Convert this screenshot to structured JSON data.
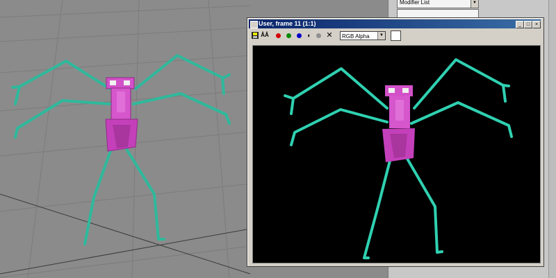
{
  "window": {
    "title": "User, frame 11 (1:1)",
    "minimize_label": "_",
    "maximize_label": "□",
    "close_label": "×"
  },
  "toolbar": {
    "save_icon": "save-icon",
    "clone_icon": "clone-icon",
    "clone_label": "ÂÂ",
    "red_channel_color": "#d40000",
    "green_channel_color": "#008a00",
    "blue_channel_color": "#0000c8",
    "mono_label": "◐",
    "clear_label": "✕",
    "channel_value": "RGB Alpha",
    "channel_dropdown": "▼"
  },
  "command_panel": {
    "modifier_list": "Modifier List",
    "dropdown": "▼"
  },
  "colors": {
    "skeleton": "#2fd1b1",
    "body": "#d250c8",
    "body_dark": "#a9359f",
    "viewport_bg": "#8b8b8b",
    "render_bg": "#000000"
  }
}
